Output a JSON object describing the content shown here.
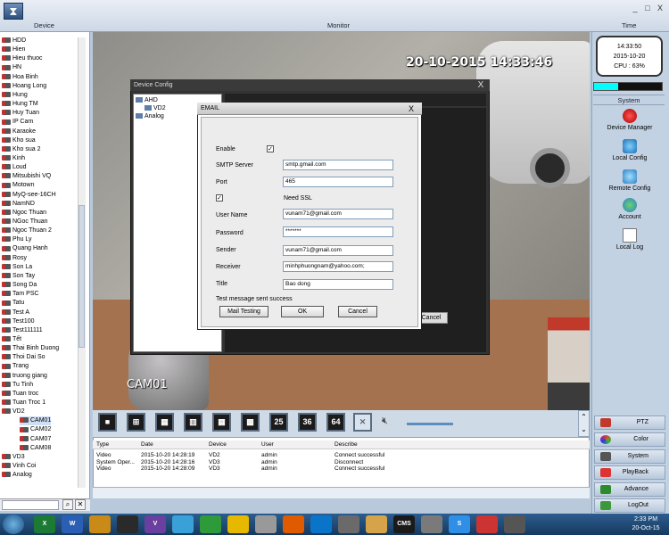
{
  "header": {
    "col_device": "Device",
    "col_monitor": "Monitor",
    "col_time": "Time",
    "window_buttons": [
      "_",
      "□",
      "X"
    ]
  },
  "tree": {
    "items": [
      "HDD",
      "Hien",
      "Hieu thuoc",
      "HN",
      "Hoa Binh",
      "Hoang Long",
      "Hung",
      "Hung TM",
      "Huy Tuan",
      "IP Cam",
      "Karaoke",
      "Kho sua",
      "Kho sua 2",
      "Kinh",
      "Loud",
      "Mitsubishi VQ",
      "Motown",
      "MyQ-see-16CH",
      "NamND",
      "Ngoc Thuan",
      "NGoc Thuan",
      "Ngoc Thuan 2",
      "Phu Ly",
      "Quang Hanh",
      "Rosy",
      "Son La",
      "Son Tay",
      "Song  Da",
      "Tam PSC",
      "Tatu",
      "Test A",
      "Test100",
      "Test111111",
      "Tết",
      "Thai Binh Duong",
      "Thoi Dai So",
      "Trang",
      "truong giang",
      "Tu Tinh",
      "Tuan troc",
      "Tuan Troc 1",
      "VD2",
      "CAM01",
      "CAM02",
      "CAM07",
      "CAM08",
      "VD3",
      "Vinh Coi",
      "Analog"
    ],
    "search_icon": "search-icon",
    "clear_icon": "clear-icon"
  },
  "monitor": {
    "osd_time": "20-10-2015 14:33:46",
    "osd_camera": "CAM01"
  },
  "device_config": {
    "title": "Device Config",
    "close": "X",
    "tree": [
      "AHD",
      "VD2",
      "Analog"
    ],
    "cancel_behind": "Cancel"
  },
  "email": {
    "title": "EMAIL",
    "close": "X",
    "enable_label": "Enable",
    "enable_checked": "✓",
    "smtp_label": "SMTP Server",
    "smtp_value": "smtp.gmail.com",
    "port_label": "Port",
    "port_value": "465",
    "ssl_checked": "✓",
    "ssl_label": "Need SSL",
    "username_label": "User Name",
    "username_value": "vunam71@gmail.com",
    "password_label": "Password",
    "password_value": "*******",
    "sender_label": "Sender",
    "sender_value": "vunam71@gmail.com",
    "receiver_label": "Receiver",
    "receiver_value": "minhphuongnam@yahoo.com;",
    "title_label": "Title",
    "title_value": "Bao dong",
    "status_text": "Test message sent success",
    "mail_testing_button": "Mail Testing",
    "ok_button": "OK",
    "cancel_button": "Cancel"
  },
  "toolbar": {
    "layout_buttons": [
      "",
      "",
      "",
      "",
      "",
      "",
      "25",
      "36",
      "64"
    ]
  },
  "log": {
    "headers": [
      "Type",
      "Date",
      "Device",
      "User",
      "Describe"
    ],
    "rows": [
      [
        "Video",
        "2015-10-20 14:28:19",
        "VD2",
        "admin",
        "Connect successful"
      ],
      [
        "System Oper...",
        "2015-10-20 14:28:16",
        "VD3",
        "admin",
        "Disconnect"
      ],
      [
        "Video",
        "2015-10-20 14:28:09",
        "VD3",
        "admin",
        "Connect successful"
      ]
    ]
  },
  "right_panel": {
    "clock_time": "14:33:50",
    "clock_date": "2015-10-20",
    "cpu": "CPU : 63%",
    "disk_usage_fraction": 0.35,
    "system_heading": "System",
    "buttons": [
      "Device Manager",
      "Local Config",
      "Remote Config",
      "Account",
      "Local Log"
    ],
    "bottom_buttons": [
      "PTZ",
      "Color",
      "System",
      "PlayBack",
      "Advance",
      "LogOut"
    ]
  },
  "taskbar": {
    "apps": [
      "X",
      "W",
      "",
      "",
      "V",
      "",
      "",
      "",
      "",
      "",
      "",
      "",
      "",
      "CMS",
      "",
      "S",
      "",
      ""
    ],
    "time": "2:33 PM",
    "date": "20-Oct-15"
  },
  "colors": {
    "accent": "#5c8ec0",
    "panel": "#c3d2e3",
    "taskbar": "#16395e"
  }
}
